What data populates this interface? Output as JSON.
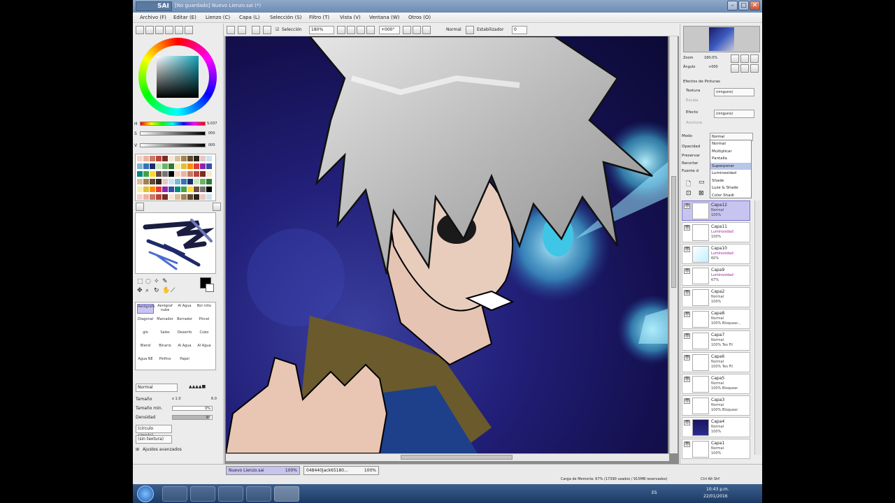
{
  "window": {
    "app_name": "SAI",
    "title": "[No guardado] Nuevo Lienzo.sai (*)",
    "controls": [
      "–",
      "□",
      "✕"
    ]
  },
  "menu": [
    "Archivo (F)",
    "Editar (E)",
    "Lienzo (C)",
    "Capa (L)",
    "Selección (S)",
    "Filtro (T)",
    "Vista (V)",
    "Ventana (W)",
    "Otros (O)"
  ],
  "toolbar": {
    "selection_label": "Selección",
    "zoom": "180%",
    "angle": "+000°",
    "mode": "Normal",
    "stabilizer_label": "Estabilizador",
    "stabilizer_value": "0"
  },
  "color": {
    "h_label": "H",
    "h_value": "S:037",
    "s_label": "S",
    "s_value": "000",
    "v_label": "V",
    "v_value": "000",
    "current": "#000000",
    "accent": "#15a3b8"
  },
  "tools": {
    "brushes": [
      {
        "name": "Aerógrafo"
      },
      {
        "name": "Aerógraf nube"
      },
      {
        "name": "Al Agua"
      },
      {
        "name": "Bol niño"
      },
      {
        "name": "Diagonal"
      },
      {
        "name": "Marcador"
      },
      {
        "name": "Borrador"
      },
      {
        "name": "Pincel"
      },
      {
        "name": "glo"
      },
      {
        "name": "Sales"
      },
      {
        "name": "Desenfo"
      },
      {
        "name": "Cubo"
      },
      {
        "name": "Blend"
      },
      {
        "name": "Binario"
      },
      {
        "name": "Al Agua"
      },
      {
        "name": "Al Agua"
      },
      {
        "name": "Agua NE"
      },
      {
        "name": "Pinfino"
      },
      {
        "name": "Papel"
      }
    ],
    "blend_mode": "Normal",
    "size_label": "Tamaño",
    "size_mult": "x 1.0",
    "size_value": "6.0",
    "min_size_label": "Tamaño mín.",
    "min_size_value": "0%",
    "density_label": "Densidad",
    "density_value": "93",
    "shape": "(círculo simple)",
    "texture": "(sin textura)",
    "advanced_label": "Ajustes avanzados"
  },
  "navigator": {
    "zoom_label": "Zoom",
    "zoom_value": "180.0%",
    "angle_label": "Ángulo",
    "angle_value": "+000"
  },
  "paint_effects": {
    "header": "Efectos de Pinturas",
    "texture_label": "Textura",
    "texture_value": "(ninguno)",
    "scale_label": "Escala",
    "effect_label": "Efecto",
    "effect_value": "(ninguno)",
    "width_label": "Anchura"
  },
  "layer_props": {
    "mode_label": "Modo",
    "mode_value": "Normal",
    "opacity_label": "Opacidad",
    "preserve_label": "Preservar",
    "clip_label": "Recortar",
    "source_label": "Fuente d"
  },
  "blend_options": [
    "Normal",
    "Multiplicar",
    "Pantalla",
    "Superponer",
    "Luminosidad",
    "Shade",
    "Luze & Shade",
    "Color Shadr"
  ],
  "blend_highlight_index": 3,
  "layers": [
    {
      "name": "Capa12",
      "mode": "Normal",
      "opacity": "100%",
      "selected": true
    },
    {
      "name": "Capa11",
      "mode": "Luminosidad",
      "opacity": "100%"
    },
    {
      "name": "Capa10",
      "mode": "Luminosidad",
      "opacity": "60%"
    },
    {
      "name": "Capa9",
      "mode": "Luminosidad",
      "opacity": "67%"
    },
    {
      "name": "Capa2",
      "mode": "Normal",
      "opacity": "100%"
    },
    {
      "name": "Capa8",
      "mode": "Normal",
      "opacity": "100% Bloquear..."
    },
    {
      "name": "Capa7",
      "mode": "Normal",
      "opacity": "100% Tex Fil"
    },
    {
      "name": "Capa6",
      "mode": "Normal",
      "opacity": "100% Tex Fil"
    },
    {
      "name": "Capa5",
      "mode": "Normal",
      "opacity": "100% Bloquear"
    },
    {
      "name": "Capa3",
      "mode": "Normal",
      "opacity": "100% Bloquear"
    },
    {
      "name": "Capa4",
      "mode": "Normal",
      "opacity": "100%"
    },
    {
      "name": "Capa1",
      "mode": "Normal",
      "opacity": "100%"
    }
  ],
  "documents": [
    {
      "name": "Nuevo Lienzo.sai",
      "zoom": "100%"
    },
    {
      "name": "048440jack65180...",
      "zoom": "100%"
    }
  ],
  "status": {
    "memory": "Carga de Memoria: 67% (17390 usados / 915MB reservados)",
    "keys": "Ctrl Alt Shf"
  },
  "taskbar": {
    "lang": "ES",
    "time": "10:43 p.m.",
    "date": "22/01/2016"
  }
}
